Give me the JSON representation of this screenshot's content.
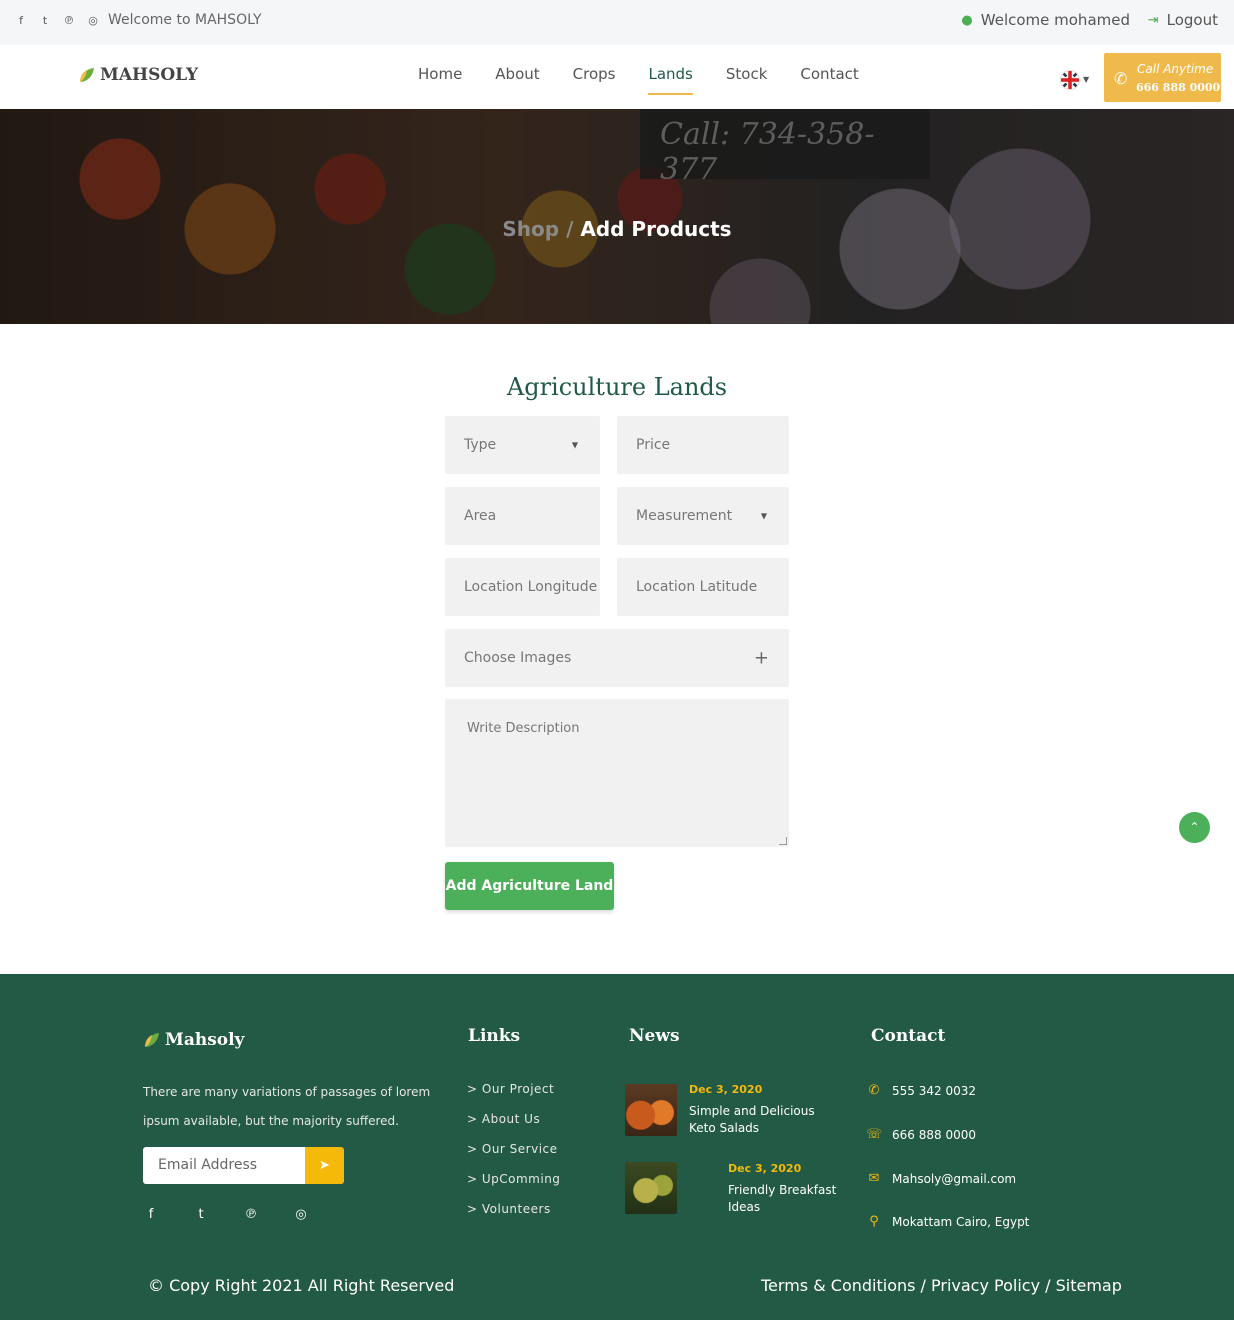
{
  "topbar": {
    "social_icons": [
      "facebook-icon",
      "twitter-icon",
      "pinterest-icon",
      "instagram-icon"
    ],
    "welcome": "Welcome to MAHSOLY",
    "user": "Welcome mohamed",
    "logout": "Logout"
  },
  "nav": {
    "logo": "MAHSOLY",
    "items": [
      "Home",
      "About",
      "Crops",
      "Lands",
      "Stock",
      "Contact"
    ],
    "active": "Lands",
    "call_line1": "Call Anytime",
    "call_line2": "666 888 0000"
  },
  "hero": {
    "crumb_parent": "Shop",
    "crumb_sep": "/",
    "crumb_current": "Add Products",
    "board_text": "Call: 734-358-377"
  },
  "form": {
    "title": "Agriculture Lands",
    "type_placeholder": "Type",
    "price_placeholder": "Price",
    "area_placeholder": "Area",
    "measurement_placeholder": "Measurement",
    "longitude_placeholder": "Location Longitude",
    "latitude_placeholder": "Location Latitude",
    "images_placeholder": "Choose Images",
    "description_placeholder": "Write Description",
    "submit_label": "Add Agriculture Land"
  },
  "footer": {
    "logo": "Mahsoly",
    "about_text": "There are many variations of passages of lorem ipsum available, but the majority suffered.",
    "email_placeholder": "Email Address",
    "links_title": "Links",
    "links": [
      "> Our Project",
      "> About Us",
      "> Our Service",
      "> UpComming",
      "> Volunteers"
    ],
    "news_title": "News",
    "news": [
      {
        "date": "Dec 3, 2020",
        "title": "Simple and Delicious Keto Salads"
      },
      {
        "date": "Dec 3, 2020",
        "title": "Friendly Breakfast Ideas"
      }
    ],
    "contact_title": "Contact",
    "contact": {
      "whatsapp": "555 342 0032",
      "phone": "666 888 0000",
      "email": "Mahsoly@gmail.com",
      "address": "Mokattam Cairo, Egypt"
    },
    "copyright": "© Copy Right 2021 All Right Reserved",
    "terms": "Terms & Conditions / Privacy Policy / Sitemap"
  },
  "colors": {
    "brand_green": "#225a45",
    "accent_gold": "#f0b94c",
    "button_green": "#4caf5a"
  }
}
